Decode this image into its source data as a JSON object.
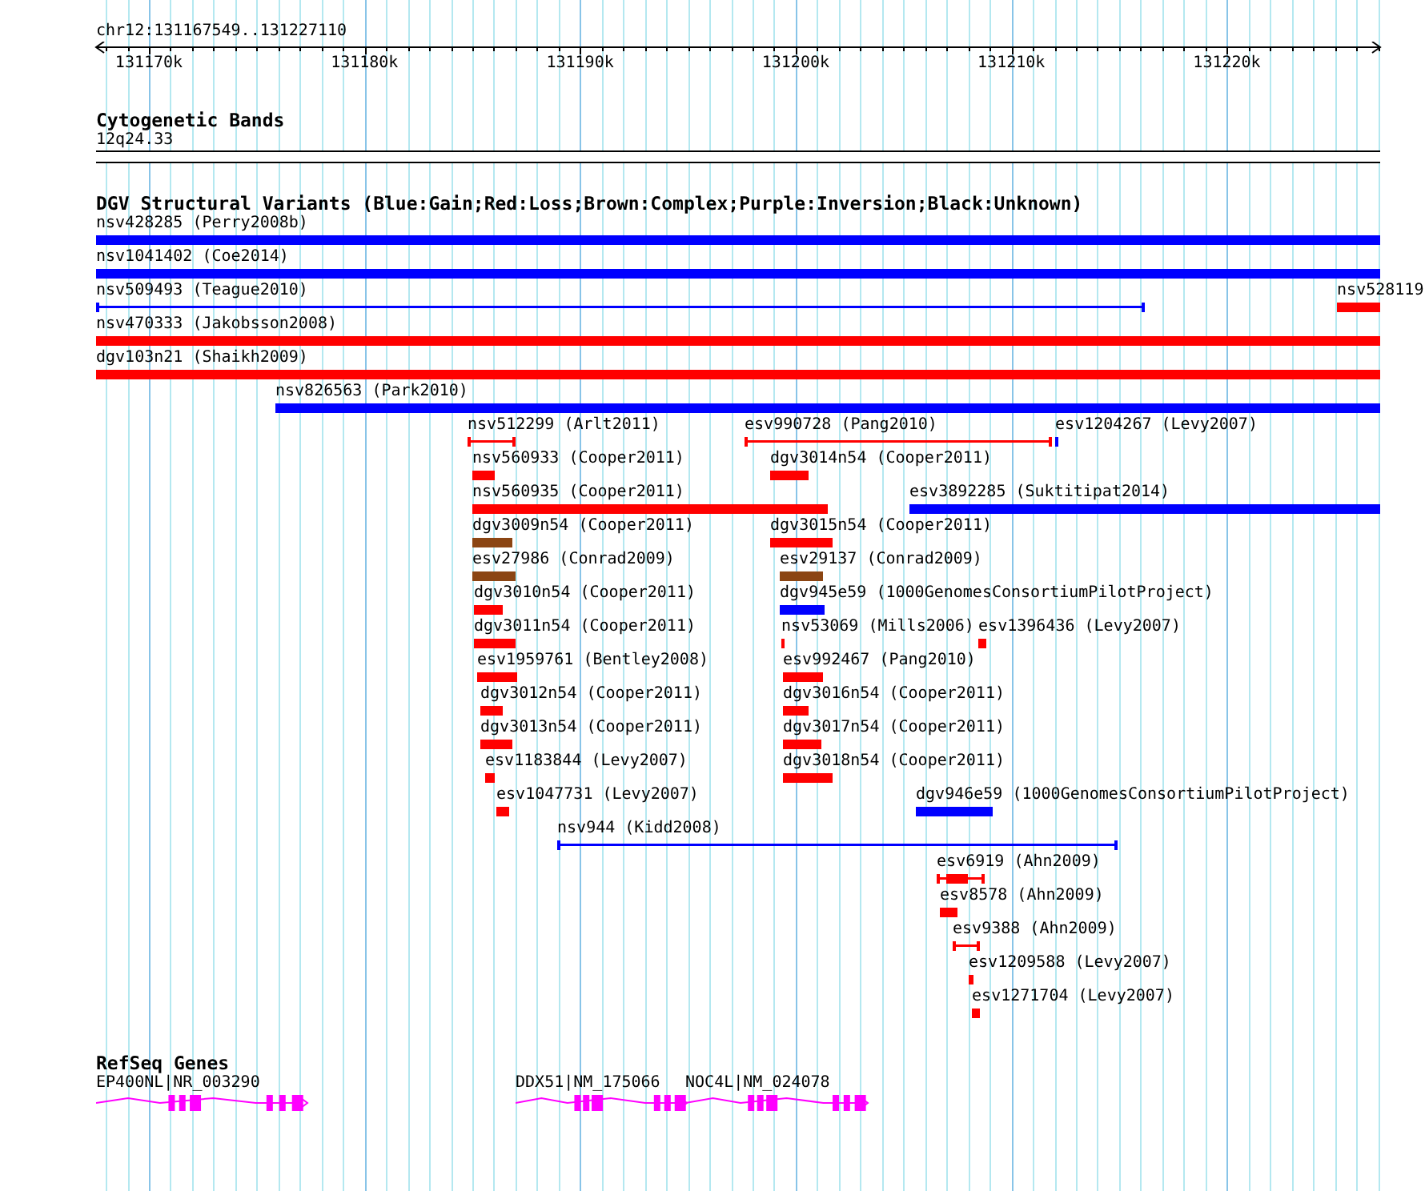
{
  "ruler": {
    "location": "chr12:131167549..131227110",
    "ticks": [
      {
        "label": "131170k"
      },
      {
        "label": "131180k"
      },
      {
        "label": "131190k"
      },
      {
        "label": "131200k"
      },
      {
        "label": "131210k"
      },
      {
        "label": "131220k"
      }
    ]
  },
  "cytogenetic_bands": {
    "title": "Cytogenetic Bands",
    "band": "12q24.33"
  },
  "dgv_track": {
    "title": "DGV Structural Variants (Blue:Gain;Red:Loss;Brown:Complex;Purple:Inversion;Black:Unknown)",
    "lanes": [
      [
        {
          "label": "nsv428285 (Perry2008b)",
          "kind": "block",
          "color": "#0000ff"
        }
      ],
      [
        {
          "label": "nsv1041402 (Coe2014)",
          "kind": "block",
          "color": "#0000ff"
        }
      ],
      [
        {
          "label": "nsv509493 (Teague2010)",
          "kind": "line",
          "color": "#0000ff"
        },
        {
          "label": "nsv528119",
          "kind": "block",
          "color": "#ff0000"
        }
      ],
      [
        {
          "label": "nsv470333 (Jakobsson2008)",
          "kind": "block",
          "color": "#ff0000"
        }
      ],
      [
        {
          "label": "dgv103n21 (Shaikh2009)",
          "kind": "block",
          "color": "#ff0000"
        }
      ],
      [
        {
          "label": "nsv826563 (Park2010)",
          "kind": "block",
          "color": "#0000ff"
        }
      ],
      [
        {
          "label": "nsv512299 (Arlt2011)",
          "kind": "line",
          "color": "#ff0000"
        },
        {
          "label": "esv990728 (Pang2010)",
          "kind": "line",
          "color": "#ff0000"
        },
        {
          "label": "esv1204267 (Levy2007)",
          "kind": "block",
          "color": "#0000ff"
        }
      ],
      [
        {
          "label": "nsv560933 (Cooper2011)",
          "kind": "block",
          "color": "#ff0000"
        },
        {
          "label": "dgv3014n54 (Cooper2011)",
          "kind": "block",
          "color": "#ff0000"
        }
      ],
      [
        {
          "label": "nsv560935 (Cooper2011)",
          "kind": "block",
          "color": "#ff0000"
        },
        {
          "label": "esv3892285 (Suktitipat2014)",
          "kind": "block",
          "color": "#0000ff"
        }
      ],
      [
        {
          "label": "dgv3009n54 (Cooper2011)",
          "kind": "block",
          "color": "#8b4513"
        },
        {
          "label": "dgv3015n54 (Cooper2011)",
          "kind": "block",
          "color": "#ff0000"
        }
      ],
      [
        {
          "label": "esv27986 (Conrad2009)",
          "kind": "block",
          "color": "#8b4513"
        },
        {
          "label": "esv29137 (Conrad2009)",
          "kind": "block",
          "color": "#8b4513"
        }
      ],
      [
        {
          "label": "dgv3010n54 (Cooper2011)",
          "kind": "block",
          "color": "#ff0000"
        },
        {
          "label": "dgv945e59 (1000GenomesConsortiumPilotProject)",
          "kind": "block",
          "color": "#0000ff"
        }
      ],
      [
        {
          "label": "dgv3011n54 (Cooper2011)",
          "kind": "block",
          "color": "#ff0000"
        },
        {
          "label": "nsv53069 (Mills2006)",
          "kind": "block",
          "color": "#ff0000"
        },
        {
          "label": "esv1396436 (Levy2007)",
          "kind": "block",
          "color": "#ff0000"
        }
      ],
      [
        {
          "label": "esv1959761 (Bentley2008)",
          "kind": "block",
          "color": "#ff0000"
        },
        {
          "label": "esv992467 (Pang2010)",
          "kind": "block",
          "color": "#ff0000"
        }
      ],
      [
        {
          "label": "dgv3012n54 (Cooper2011)",
          "kind": "block",
          "color": "#ff0000"
        },
        {
          "label": "dgv3016n54 (Cooper2011)",
          "kind": "block",
          "color": "#ff0000"
        }
      ],
      [
        {
          "label": "dgv3013n54 (Cooper2011)",
          "kind": "block",
          "color": "#ff0000"
        },
        {
          "label": "dgv3017n54 (Cooper2011)",
          "kind": "block",
          "color": "#ff0000"
        }
      ],
      [
        {
          "label": "esv1183844 (Levy2007)",
          "kind": "block",
          "color": "#ff0000"
        },
        {
          "label": "dgv3018n54 (Cooper2011)",
          "kind": "block",
          "color": "#ff0000"
        }
      ],
      [
        {
          "label": "esv1047731 (Levy2007)",
          "kind": "block",
          "color": "#ff0000"
        },
        {
          "label": "dgv946e59 (1000GenomesConsortiumPilotProject)",
          "kind": "block",
          "color": "#0000ff"
        }
      ],
      [
        {
          "label": "nsv944 (Kidd2008)",
          "kind": "line",
          "color": "#0000ff"
        }
      ],
      [
        {
          "label": "esv6919 (Ahn2009)",
          "kind": "mixed",
          "color": "#ff0000"
        }
      ],
      [
        {
          "label": "esv8578 (Ahn2009)",
          "kind": "block",
          "color": "#ff0000"
        }
      ],
      [
        {
          "label": "esv9388 (Ahn2009)",
          "kind": "line",
          "color": "#ff0000"
        }
      ],
      [
        {
          "label": "esv1209588 (Levy2007)",
          "kind": "block",
          "color": "#ff0000"
        }
      ],
      [
        {
          "label": "esv1271704 (Levy2007)",
          "kind": "block",
          "color": "#ff0000"
        }
      ]
    ]
  },
  "refseq_track": {
    "title": "RefSeq Genes",
    "genes": [
      {
        "label": "EP400NL|NR_003290"
      },
      {
        "label": "DDX51|NM_175066"
      },
      {
        "label": "NOC4L|NM_024078"
      }
    ]
  }
}
